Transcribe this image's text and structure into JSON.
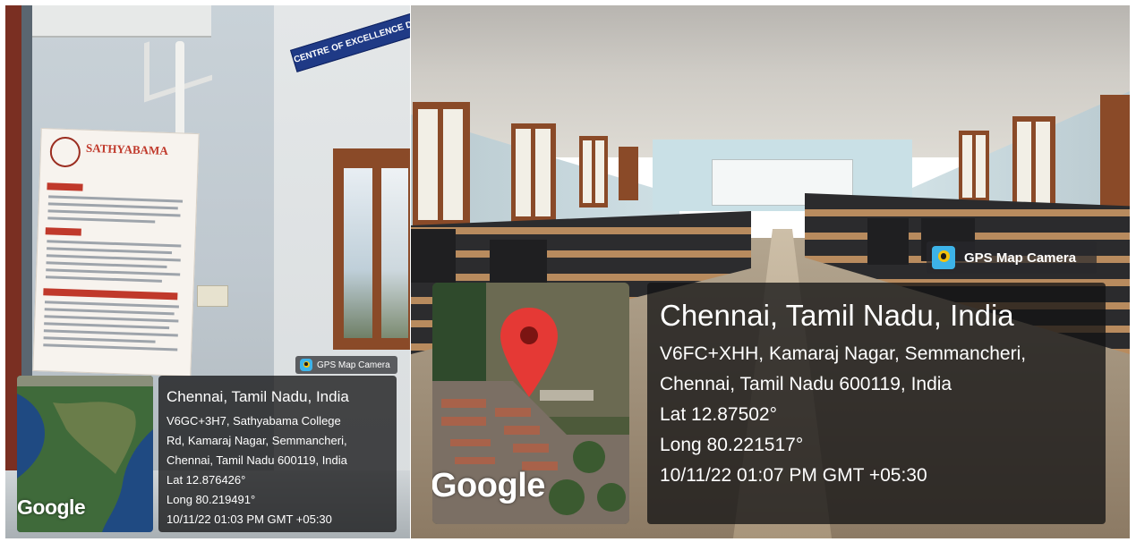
{
  "left_photo": {
    "sign_text": "CENTRE OF EXCELLENCE DATA SCIENCE LAB",
    "poster_title": "SATHYABAMA",
    "badge_label": "GPS Map Camera",
    "map_watermark": "Google",
    "location": {
      "title": "Chennai, Tamil Nadu, India",
      "address_lines": [
        "V6GC+3H7, Sathyabama College",
        "Rd, Kamaraj Nagar, Semmancheri,",
        "Chennai, Tamil Nadu 600119, India"
      ],
      "lat": "Lat 12.876426°",
      "long": "Long 80.219491°",
      "datetime": "10/11/22 01:03 PM GMT +05:30"
    }
  },
  "right_photo": {
    "badge_label": "GPS Map Camera",
    "map_watermark": "Google",
    "location": {
      "title": "Chennai, Tamil Nadu, India",
      "address_lines": [
        "V6FC+XHH, Kamaraj Nagar, Semmancheri,",
        "Chennai, Tamil Nadu 600119, India"
      ],
      "lat": "Lat 12.87502°",
      "long": "Long 80.221517°",
      "datetime": "10/11/22 01:07 PM GMT +05:30"
    }
  },
  "colors": {
    "overlay_bg": "#121214",
    "map_pin": "#e53935",
    "sign_blue": "#1f3a86",
    "window_frame": "#8a4a28"
  },
  "icons": [
    "gps-map-camera-icon",
    "map-pin-icon"
  ]
}
